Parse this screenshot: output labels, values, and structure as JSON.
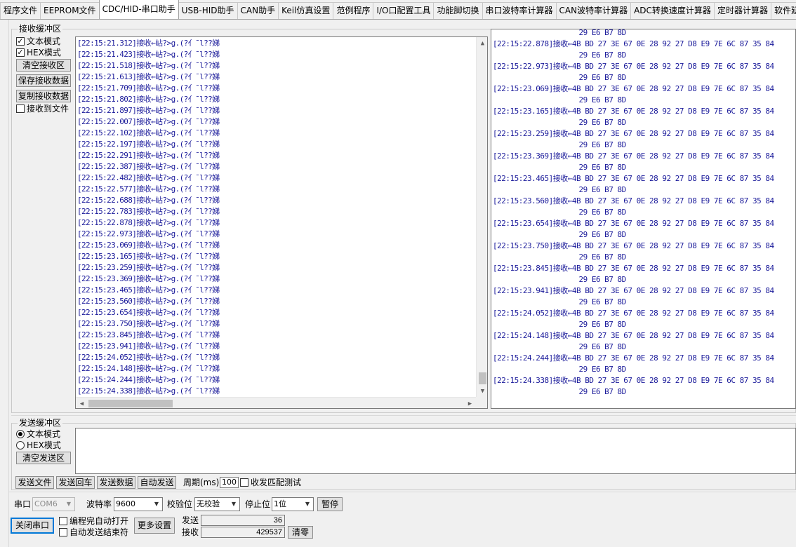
{
  "tabs": [
    "程序文件",
    "EEPROM文件",
    "CDC/HID-串口助手",
    "USB-HID助手",
    "CAN助手",
    "Keil仿真设置",
    "范例程序",
    "I/O口配置工具",
    "功能脚切换",
    "串口波特率计算器",
    "CAN波特率计算器",
    "ADC转换速度计算器",
    "定时器计算器",
    "软件延时"
  ],
  "active_tab_index": 2,
  "receive": {
    "title": "接收缓冲区",
    "text_mode_label": "文本模式",
    "text_mode_checked": "✓",
    "hex_mode_label": "HEX模式",
    "hex_mode_checked": "✓",
    "clear_btn": "清空接收区",
    "save_btn": "保存接收数据",
    "copy_btn": "复制接收数据",
    "to_file_label": "接收到文件",
    "text_lines": [
      "[22:15:21.312]接收←岾?>g.(?亻¯l??娣",
      "[22:15:21.423]接收←岾?>g.(?亻¯l??娣",
      "[22:15:21.518]接收←岾?>g.(?亻¯l??娣",
      "[22:15:21.613]接收←岾?>g.(?亻¯l??娣",
      "[22:15:21.709]接收←岾?>g.(?亻¯l??娣",
      "[22:15:21.802]接收←岾?>g.(?亻¯l??娣",
      "[22:15:21.897]接收←岾?>g.(?亻¯l??娣",
      "[22:15:22.007]接收←岾?>g.(?亻¯l??娣",
      "[22:15:22.102]接收←岾?>g.(?亻¯l??娣",
      "[22:15:22.197]接收←岾?>g.(?亻¯l??娣",
      "[22:15:22.291]接收←岾?>g.(?亻¯l??娣",
      "[22:15:22.387]接收←岾?>g.(?亻¯l??娣",
      "[22:15:22.482]接收←岾?>g.(?亻¯l??娣",
      "[22:15:22.577]接收←岾?>g.(?亻¯l??娣",
      "[22:15:22.688]接收←岾?>g.(?亻¯l??娣",
      "[22:15:22.783]接收←岾?>g.(?亻¯l??娣",
      "[22:15:22.878]接收←岾?>g.(?亻¯l??娣",
      "[22:15:22.973]接收←岾?>g.(?亻¯l??娣",
      "[22:15:23.069]接收←岾?>g.(?亻¯l??娣",
      "[22:15:23.165]接收←岾?>g.(?亻¯l??娣",
      "[22:15:23.259]接收←岾?>g.(?亻¯l??娣",
      "[22:15:23.369]接收←岾?>g.(?亻¯l??娣",
      "[22:15:23.465]接收←岾?>g.(?亻¯l??娣",
      "[22:15:23.560]接收←岾?>g.(?亻¯l??娣",
      "[22:15:23.654]接收←岾?>g.(?亻¯l??娣",
      "[22:15:23.750]接收←岾?>g.(?亻¯l??娣",
      "[22:15:23.845]接收←岾?>g.(?亻¯l??娣",
      "[22:15:23.941]接收←岾?>g.(?亻¯l??娣",
      "[22:15:24.052]接收←岾?>g.(?亻¯l??娣",
      "[22:15:24.148]接收←岾?>g.(?亻¯l??娣",
      "[22:15:24.244]接收←岾?>g.(?亻¯l??娣",
      "[22:15:24.338]接收←岾?>g.(?亻¯l??娣"
    ],
    "hex_lines": [
      "                    29 E6 B7 8D",
      "[22:15:22.878]接收←4B BD 27 3E 67 0E 28 92 27 D8 E9 7E 6C 87 35 84",
      "                    29 E6 B7 8D",
      "[22:15:22.973]接收←4B BD 27 3E 67 0E 28 92 27 D8 E9 7E 6C 87 35 84",
      "                    29 E6 B7 8D",
      "[22:15:23.069]接收←4B BD 27 3E 67 0E 28 92 27 D8 E9 7E 6C 87 35 84",
      "                    29 E6 B7 8D",
      "[22:15:23.165]接收←4B BD 27 3E 67 0E 28 92 27 D8 E9 7E 6C 87 35 84",
      "                    29 E6 B7 8D",
      "[22:15:23.259]接收←4B BD 27 3E 67 0E 28 92 27 D8 E9 7E 6C 87 35 84",
      "                    29 E6 B7 8D",
      "[22:15:23.369]接收←4B BD 27 3E 67 0E 28 92 27 D8 E9 7E 6C 87 35 84",
      "                    29 E6 B7 8D",
      "[22:15:23.465]接收←4B BD 27 3E 67 0E 28 92 27 D8 E9 7E 6C 87 35 84",
      "                    29 E6 B7 8D",
      "[22:15:23.560]接收←4B BD 27 3E 67 0E 28 92 27 D8 E9 7E 6C 87 35 84",
      "                    29 E6 B7 8D",
      "[22:15:23.654]接收←4B BD 27 3E 67 0E 28 92 27 D8 E9 7E 6C 87 35 84",
      "                    29 E6 B7 8D",
      "[22:15:23.750]接收←4B BD 27 3E 67 0E 28 92 27 D8 E9 7E 6C 87 35 84",
      "                    29 E6 B7 8D",
      "[22:15:23.845]接收←4B BD 27 3E 67 0E 28 92 27 D8 E9 7E 6C 87 35 84",
      "                    29 E6 B7 8D",
      "[22:15:23.941]接收←4B BD 27 3E 67 0E 28 92 27 D8 E9 7E 6C 87 35 84",
      "                    29 E6 B7 8D",
      "[22:15:24.052]接收←4B BD 27 3E 67 0E 28 92 27 D8 E9 7E 6C 87 35 84",
      "                    29 E6 B7 8D",
      "[22:15:24.148]接收←4B BD 27 3E 67 0E 28 92 27 D8 E9 7E 6C 87 35 84",
      "                    29 E6 B7 8D",
      "[22:15:24.244]接收←4B BD 27 3E 67 0E 28 92 27 D8 E9 7E 6C 87 35 84",
      "                    29 E6 B7 8D",
      "[22:15:24.338]接收←4B BD 27 3E 67 0E 28 92 27 D8 E9 7E 6C 87 35 84",
      "                    29 E6 B7 8D"
    ]
  },
  "send": {
    "title": "发送缓冲区",
    "text_mode_label": "文本模式",
    "hex_mode_label": "HEX模式",
    "clear_btn": "清空发送区",
    "send_file_btn": "发送文件",
    "send_enter_btn": "发送回车",
    "send_data_btn": "发送数据",
    "auto_send_btn": "自动发送",
    "period_label": "周期(ms)",
    "period_value": "100",
    "match_test_label": "收发匹配测试"
  },
  "port": {
    "port_label": "串口",
    "port_value": "COM6",
    "baud_label": "波特率",
    "baud_value": "9600",
    "parity_label": "校验位",
    "parity_value": "无校验",
    "stop_label": "停止位",
    "stop_value": "1位",
    "pause_btn": "暂停",
    "close_btn": "关闭串口",
    "auto_open_label": "编程完自动打开",
    "auto_end_label": "自动发送结束符",
    "more_btn": "更多设置",
    "sent_label": "发送",
    "sent_value": "36",
    "recv_label": "接收",
    "recv_value": "429537",
    "zero_btn": "清零"
  },
  "colors": {
    "log_text": "#1a1a9a",
    "accent": "#0078d7"
  }
}
